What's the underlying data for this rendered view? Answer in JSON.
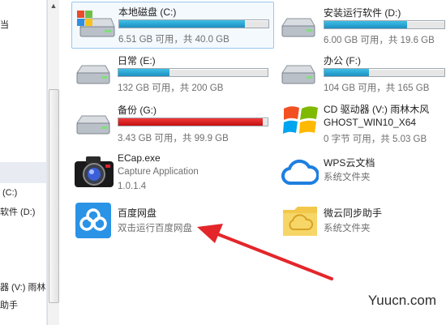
{
  "nav_pane": {
    "items": [
      {
        "label": "当"
      },
      {
        "label": "(C:)"
      },
      {
        "label": "软件 (D:)"
      },
      {
        "label": "器 (V:) 雨林"
      },
      {
        "label": "助手"
      }
    ]
  },
  "drives": [
    {
      "name": "本地磁盘 (C:)",
      "usage": "6.51 GB 可用，共 40.0 GB",
      "fill": 0.84,
      "color": "#2aa9d8",
      "icon": "hard-drive-windows-icon"
    },
    {
      "name": "安装运行软件 (D:)",
      "usage": "6.00 GB 可用，共 19.6 GB",
      "fill": 0.69,
      "color": "#2aa9d8",
      "icon": "hard-drive-icon"
    },
    {
      "name": "日常 (E:)",
      "usage": "132 GB 可用，共 200 GB",
      "fill": 0.34,
      "color": "#2aa9d8",
      "icon": "hard-drive-icon"
    },
    {
      "name": "办公 (F:)",
      "usage": "104 GB 可用，共 165 GB",
      "fill": 0.37,
      "color": "#2aa9d8",
      "icon": "hard-drive-icon"
    },
    {
      "name": "备份 (G:)",
      "usage": "3.43 GB 可用，共 99.9 GB",
      "fill": 0.97,
      "color": "#d81c1c",
      "icon": "hard-drive-icon"
    }
  ],
  "cd_drive": {
    "name": "CD 驱动器 (V:) 雨林木风",
    "label": "GHOST_WIN10_X64",
    "usage": "0 字节 可用，共 5.03 GB",
    "icon": "windows-logo-icon"
  },
  "apps": [
    {
      "name": "ECap.exe",
      "line2": "Capture Application",
      "line3": "1.0.1.4",
      "icon": "camera-icon"
    },
    {
      "name": "WPS云文档",
      "line2": "系统文件夹",
      "icon": "cloud-icon"
    },
    {
      "name": "百度网盘",
      "line2": "双击运行百度网盘",
      "icon": "baidu-netdisk-icon"
    },
    {
      "name": "微云同步助手",
      "line2": "系统文件夹",
      "icon": "weiyun-folder-icon"
    }
  ],
  "watermark": "Yuucn.com",
  "colors": {
    "accent": "#2aa9d8",
    "danger": "#d81c1c",
    "selection": "#99c8ee",
    "arrow": "#e4262a"
  }
}
